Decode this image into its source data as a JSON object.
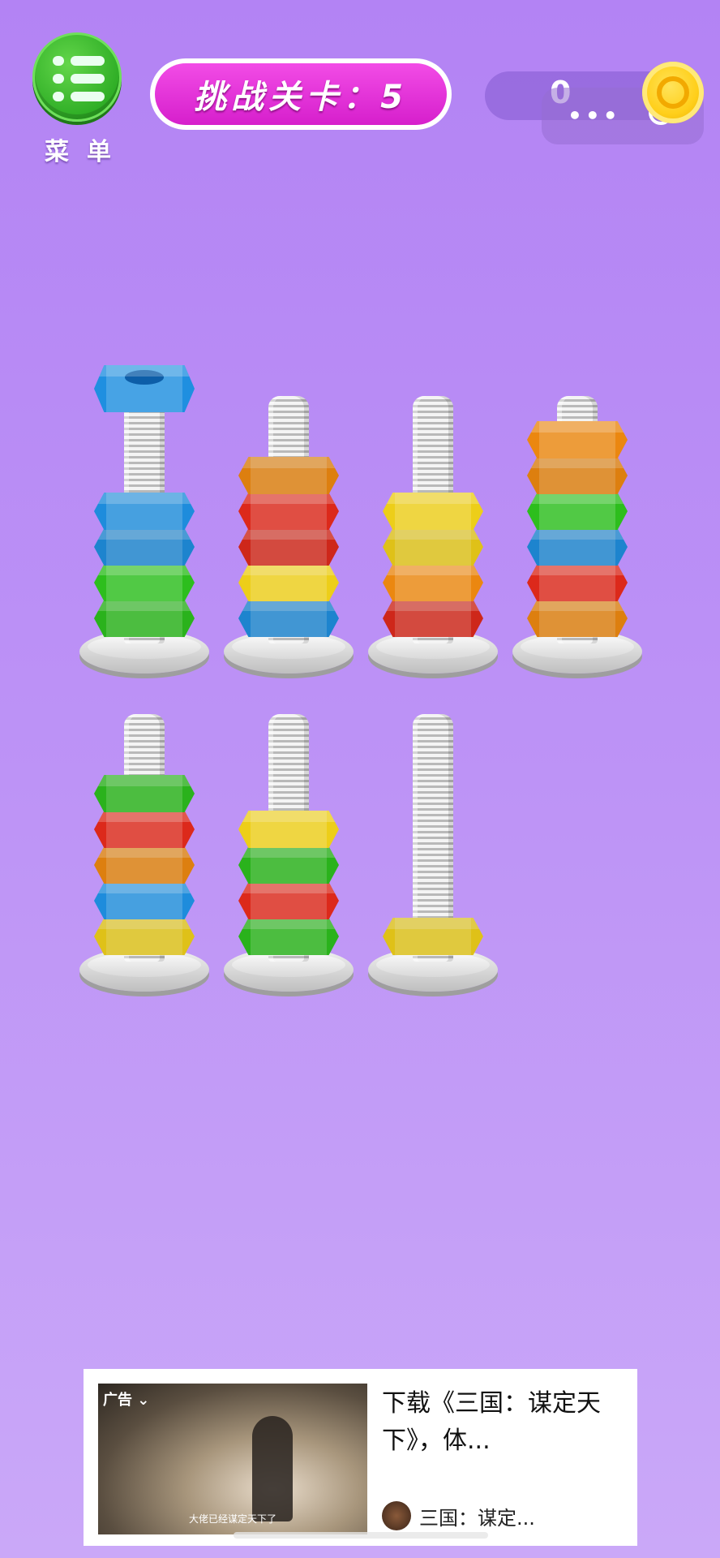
{
  "header": {
    "menu_label": "菜单",
    "level_text": "挑战关卡：5",
    "coins": "0"
  },
  "colors": {
    "blue": "#1f8fe0",
    "red": "#e02a1c",
    "green": "#2ec21e",
    "yellow": "#f2d21a",
    "orange": "#f08a10"
  },
  "pegs": [
    {
      "nuts_bottom_to_top": [
        "green",
        "green",
        "blue",
        "blue"
      ],
      "lifted_nut": "blue"
    },
    {
      "nuts_bottom_to_top": [
        "blue",
        "yellow",
        "red",
        "red",
        "orange"
      ]
    },
    {
      "nuts_bottom_to_top": [
        "red",
        "orange",
        "yellow",
        "yellow"
      ]
    },
    {
      "nuts_bottom_to_top": [
        "orange",
        "red",
        "blue",
        "green",
        "orange",
        "orange"
      ]
    },
    {
      "nuts_bottom_to_top": [
        "yellow",
        "blue",
        "orange",
        "red",
        "green"
      ]
    },
    {
      "nuts_bottom_to_top": [
        "green",
        "red",
        "green",
        "yellow"
      ]
    },
    {
      "nuts_bottom_to_top": [
        "yellow"
      ]
    }
  ],
  "ad": {
    "tag": "广告",
    "title": "下载《三国：谋定天下》，体...",
    "caption": "大佬已经谋定天下了",
    "source": "三国：谋定..."
  }
}
